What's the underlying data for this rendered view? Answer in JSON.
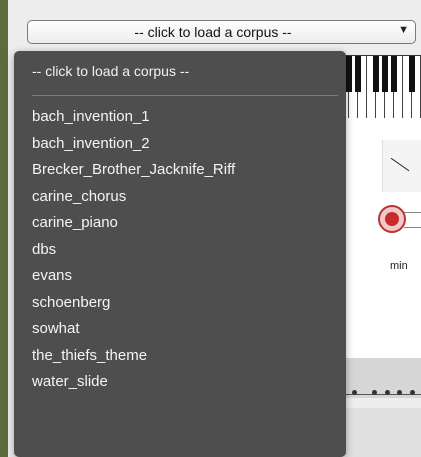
{
  "corpus_select": {
    "selected_label": "-- click to load a corpus --",
    "chevron_icon": "chevron-down-icon"
  },
  "menu": {
    "header_option": "-- click to load a corpus --",
    "items": [
      "bach_invention_1",
      "bach_invention_2",
      "Brecker_Brother_Jacknife_Riff",
      "carine_chorus",
      "carine_piano",
      "dbs",
      "evans",
      "schoenberg",
      "sowhat",
      "the_thiefs_theme",
      "water_slide"
    ]
  },
  "background": {
    "min_label": "min"
  },
  "colors": {
    "menu_bg": "#484848",
    "menu_text": "#f4f4f4",
    "record_red": "#c92a2a",
    "rail_green": "#5e6b3f"
  }
}
